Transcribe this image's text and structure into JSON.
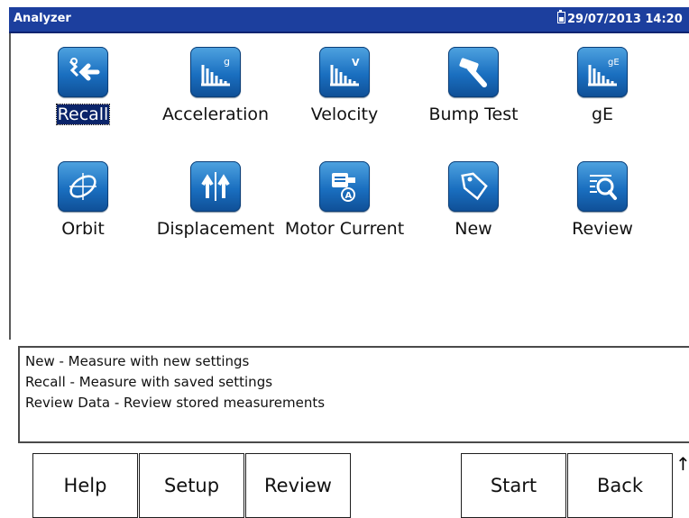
{
  "window": {
    "title": "Analyzer",
    "datetime": "29/07/2013 14:20"
  },
  "tiles": [
    {
      "label": "Recall",
      "icon": "recall-icon",
      "selected": true
    },
    {
      "label": "Acceleration",
      "icon": "acceleration-icon"
    },
    {
      "label": "Velocity",
      "icon": "velocity-icon"
    },
    {
      "label": "Bump Test",
      "icon": "hammer-icon"
    },
    {
      "label": "gE",
      "icon": "ge-icon"
    },
    {
      "label": "Orbit",
      "icon": "orbit-icon"
    },
    {
      "label": "Displacement",
      "icon": "displacement-icon"
    },
    {
      "label": "Motor Current",
      "icon": "motor-current-icon"
    },
    {
      "label": "New",
      "icon": "tag-icon"
    },
    {
      "label": "Review",
      "icon": "review-icon"
    }
  ],
  "description": {
    "lines": [
      "New - Measure with new settings",
      "Recall - Measure with saved settings",
      "Review Data - Review stored measurements"
    ]
  },
  "buttons": {
    "help": "Help",
    "setup": "Setup",
    "review": "Review",
    "start": "Start",
    "back": "Back"
  },
  "scroll_indicator": "↑",
  "colors": {
    "titlebar": "#1c3f9e",
    "icon_blue": "#1a6fc0",
    "selection": "#0a246a"
  }
}
